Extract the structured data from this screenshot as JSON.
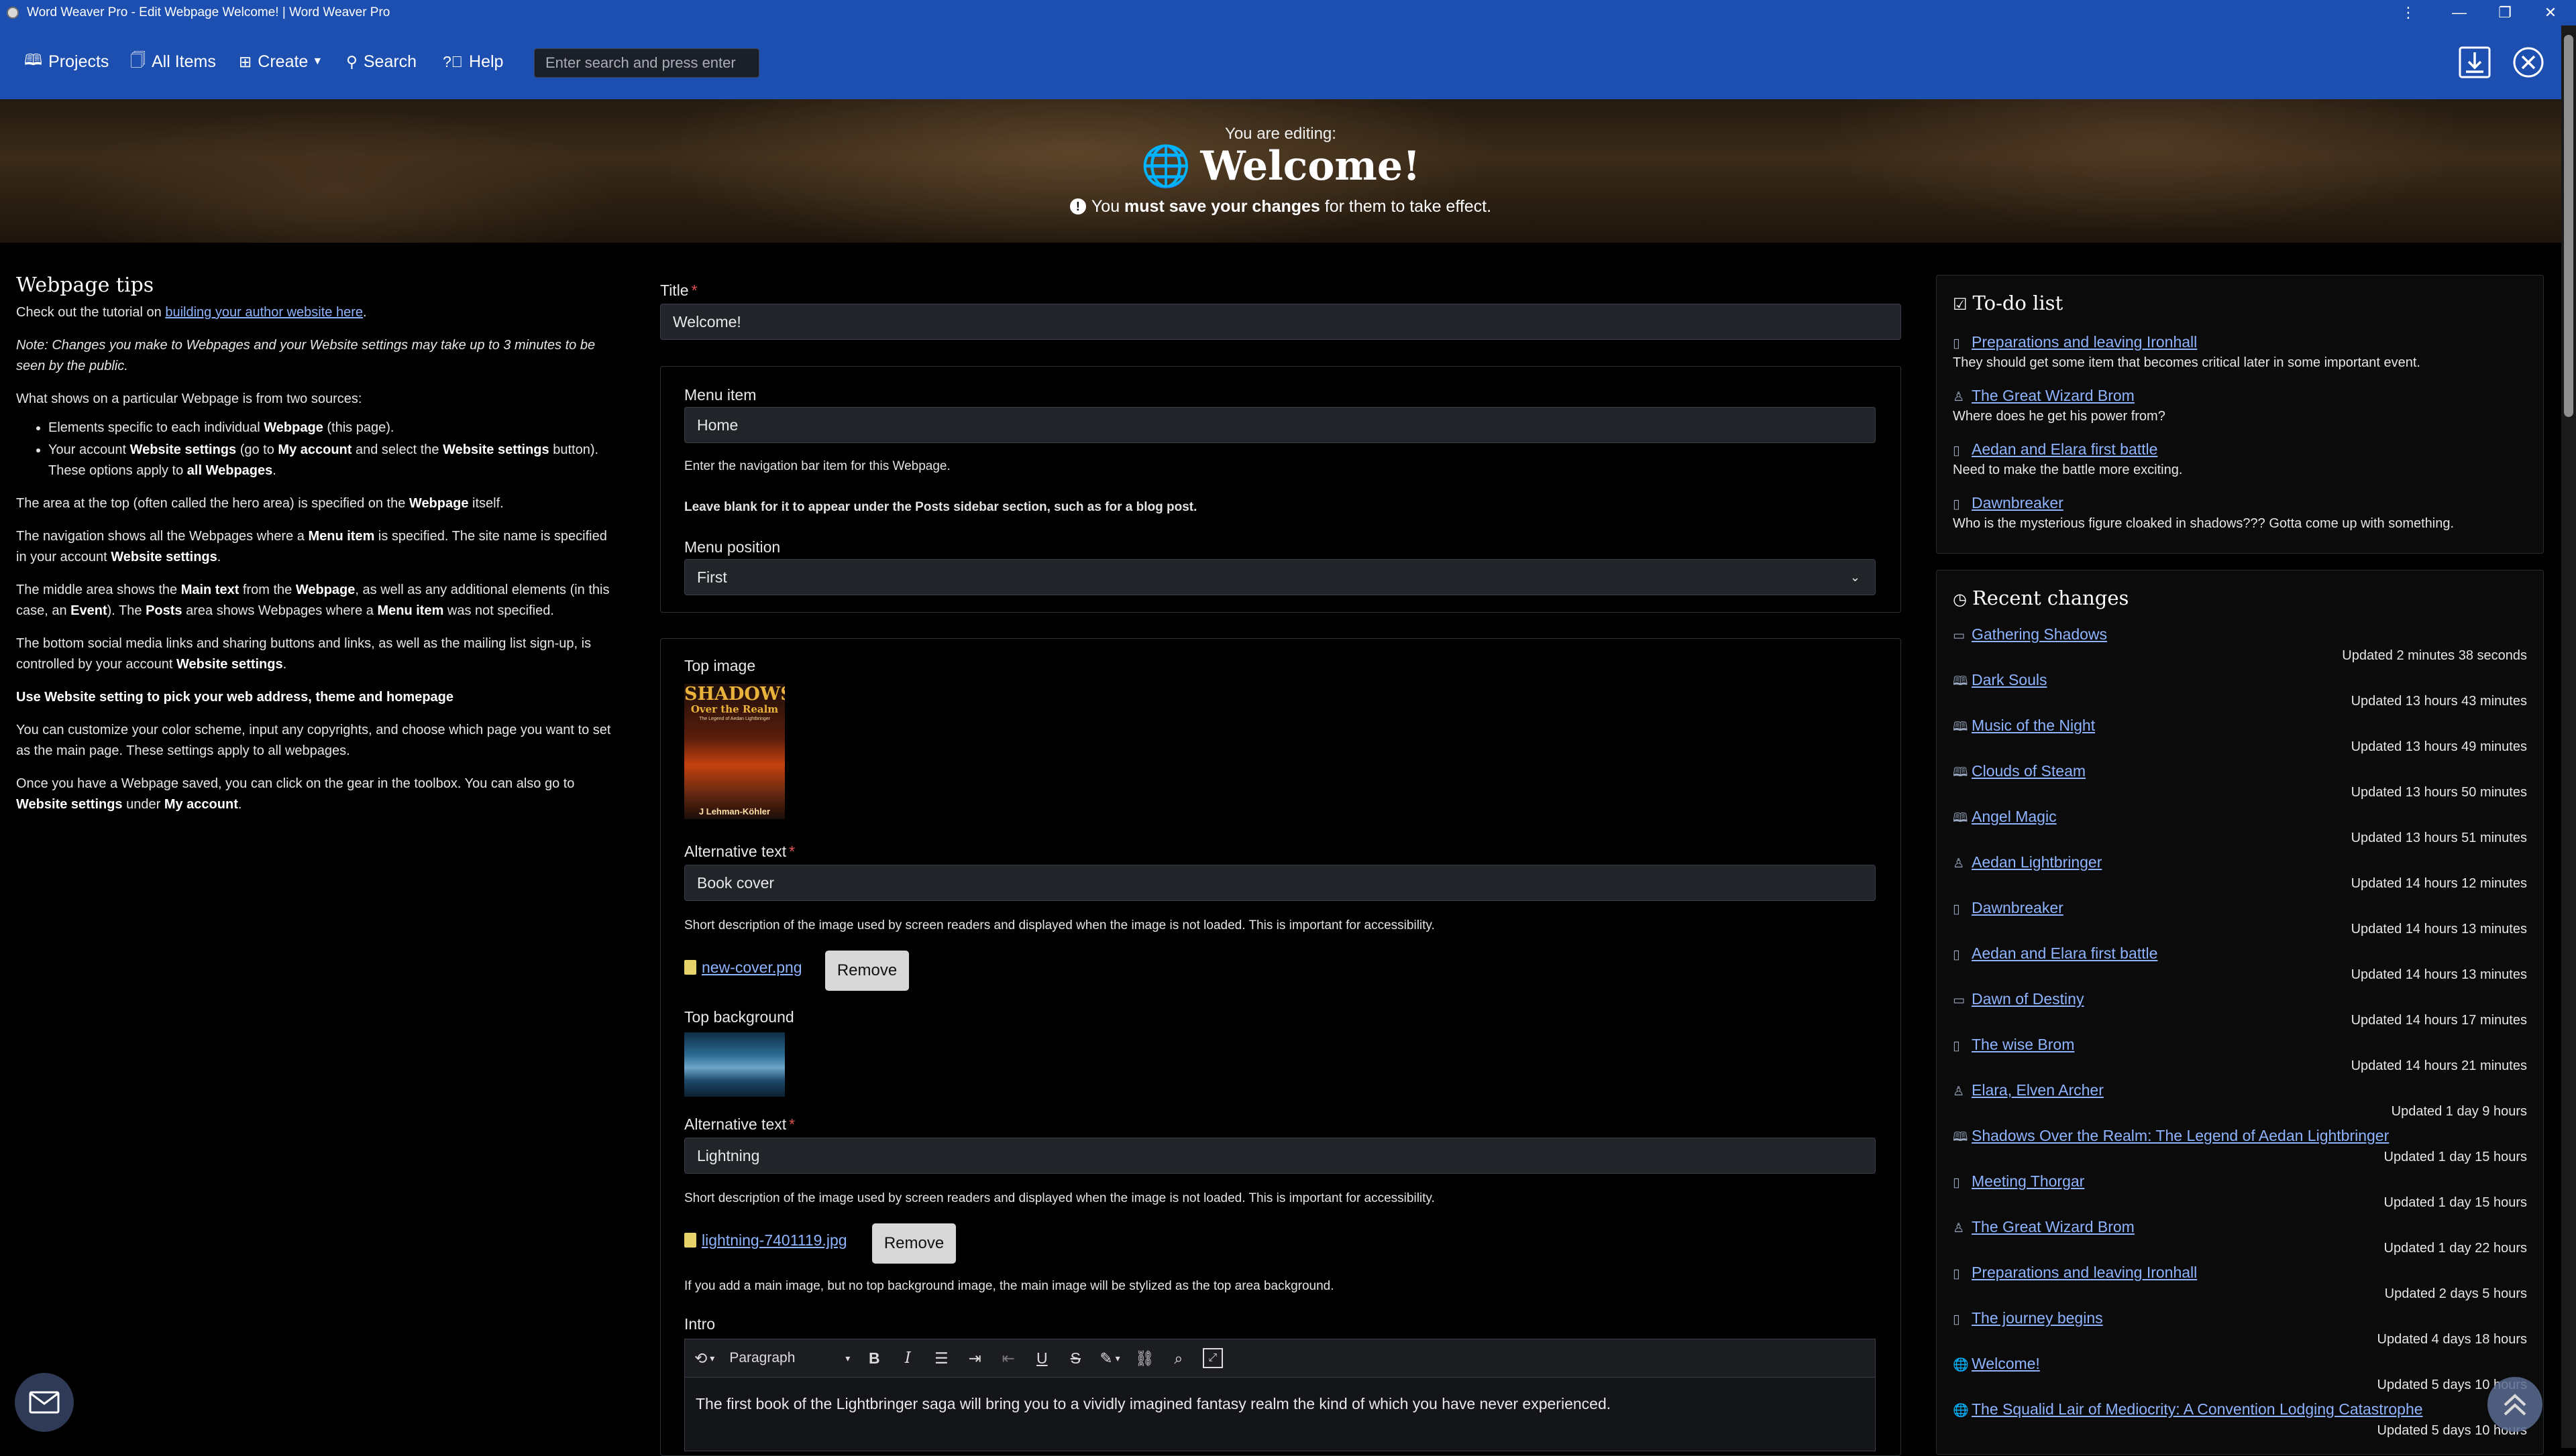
{
  "window": {
    "title": "Word Weaver Pro - Edit Webpage Welcome! | Word Weaver Pro",
    "controls": [
      "more",
      "minimize",
      "restore",
      "close"
    ]
  },
  "nav": {
    "projects": "Projects",
    "all_items": "All Items",
    "create": "Create",
    "search": "Search",
    "help": "Help",
    "search_placeholder": "Enter search and press enter"
  },
  "hero": {
    "editing_label": "You are editing:",
    "title": "Welcome!",
    "notice_pre": "You ",
    "notice_bold": "must save your changes",
    "notice_post": " for them to take effect."
  },
  "tips": {
    "heading": "Webpage tips",
    "p1_pre": "Check out the tutorial on ",
    "p1_link": "building your author website here",
    "p1_post": ".",
    "note": "Note: Changes you make to Webpages and your Website settings may take up to 3 minutes to be seen by the public.",
    "sources_intro_pre": "What shows on a particular Webpage is from two sources:",
    "li1_pre": "Elements specific to each individual ",
    "li1_bold": "Webpage",
    "li1_post": " (this page).",
    "li2_a": "Your account ",
    "li2_b": "Website settings",
    "li2_c": " (go to ",
    "li2_d": "My account",
    "li2_e": " and select the ",
    "li2_f": "Website settings",
    "li2_g": " button). These options apply to ",
    "li2_h": "all Webpages",
    "li2_i": ".",
    "hero_pre": "The area at the top (often called the hero area) is specified on the ",
    "hero_bold": "Webpage",
    "hero_post": " itself.",
    "nav_a": "The navigation shows all the Webpages where a ",
    "nav_b": "Menu item",
    "nav_c": " is specified. The site name is specified in your account ",
    "nav_d": "Website settings",
    "nav_e": ".",
    "mid_a": "The middle area shows the ",
    "mid_b": "Main text",
    "mid_c": " from the ",
    "mid_d": "Webpage",
    "mid_e": ", as well as any additional elements (in this case, an ",
    "mid_f": "Event",
    "mid_g": "). The ",
    "mid_h": "Posts",
    "mid_i": " area shows Webpages where a ",
    "mid_j": "Menu item",
    "mid_k": " was not specified.",
    "bottom_a": "The bottom social media links and sharing buttons and links, as well as the mailing list sign-up, is controlled by your account ",
    "bottom_b": "Website settings",
    "bottom_c": ".",
    "bold_line": "Use Website setting to pick your web address, theme and homepage",
    "custom": "You can customize your color scheme, input any copyrights, and choose which page you want to set as the main page. These settings apply to all webpages.",
    "once_a": "Once you have a Webpage saved, you can click on the gear in the toolbox. You can also go to ",
    "once_b": "Website settings",
    "once_c": " under ",
    "once_d": "My account",
    "once_e": "."
  },
  "form": {
    "title_label": "Title",
    "title_value": "Welcome!",
    "menu_item_label": "Menu item",
    "menu_item_value": "Home",
    "menu_hint": "Enter the navigation bar item for this Webpage.",
    "menu_hint_bold": "Leave blank for it to appear under the Posts sidebar section, such as for a blog post.",
    "menu_position_label": "Menu position",
    "menu_position_value": "First",
    "top_image_label": "Top image",
    "cover": {
      "title_line1": "SHADOWS",
      "title_line2": "Over the Realm",
      "subtitle": "The Legend of Aedan Lightbringer",
      "author": "J Lehman-Köhler"
    },
    "alt1_label": "Alternative text",
    "alt1_value": "Book cover",
    "alt_hint": "Short description of the image used by screen readers and displayed when the image is not loaded. This is important for accessibility.",
    "file1": "new-cover.png",
    "remove_label": "Remove",
    "top_bg_label": "Top background",
    "alt2_label": "Alternative text",
    "alt2_value": "Lightning",
    "alt_hint2": "Short description of the image used by screen readers and displayed when the image is not loaded. This is important for accessibility.",
    "file2": "lightning-7401119.jpg",
    "remove_label2": "Remove",
    "main_image_hint": "If you add a main image, but no top background image, the main image will be stylized as the top area background.",
    "intro_label": "Intro",
    "paragraph_select": "Paragraph",
    "intro_text": "The first book of the Lightbringer saga will bring you to a vividly imagined fantasy realm the kind of which you have never experienced."
  },
  "todo": {
    "heading": "To-do list",
    "items": [
      {
        "icon": "book-icon",
        "link": "Preparations and leaving Ironhall",
        "desc": "They should get some item that becomes critical later in some important event."
      },
      {
        "icon": "person-icon",
        "link": "The Great Wizard Brom",
        "desc": "Where does he get his power from?"
      },
      {
        "icon": "book-icon",
        "link": "Aedan and Elara first battle",
        "desc": "Need to make the battle more exciting."
      },
      {
        "icon": "book-icon",
        "link": "Dawnbreaker",
        "desc": "Who is the mysterious figure cloaked in shadows??? Gotta come up with something."
      }
    ]
  },
  "recent": {
    "heading": "Recent changes",
    "items": [
      {
        "icon": "chapter-icon",
        "link": "Gathering Shadows",
        "time": "Updated 2 minutes 38 seconds"
      },
      {
        "icon": "open-book-icon",
        "link": "Dark Souls",
        "time": "Updated 13 hours 43 minutes"
      },
      {
        "icon": "open-book-icon",
        "link": "Music of the Night",
        "time": "Updated 13 hours 49 minutes"
      },
      {
        "icon": "open-book-icon",
        "link": "Clouds of Steam",
        "time": "Updated 13 hours 50 minutes"
      },
      {
        "icon": "open-book-icon",
        "link": "Angel Magic",
        "time": "Updated 13 hours 51 minutes"
      },
      {
        "icon": "person-icon",
        "link": "Aedan Lightbringer",
        "time": "Updated 14 hours 12 minutes"
      },
      {
        "icon": "book-icon",
        "link": "Dawnbreaker",
        "time": "Updated 14 hours 13 minutes"
      },
      {
        "icon": "book-icon",
        "link": "Aedan and Elara first battle",
        "time": "Updated 14 hours 13 minutes"
      },
      {
        "icon": "chapter-icon",
        "link": "Dawn of Destiny",
        "time": "Updated 14 hours 17 minutes"
      },
      {
        "icon": "book-icon",
        "link": "The wise Brom",
        "time": "Updated 14 hours 21 minutes"
      },
      {
        "icon": "person-icon",
        "link": "Elara, Elven Archer",
        "time": "Updated 1 day 9 hours"
      },
      {
        "icon": "open-book-icon",
        "link": "Shadows Over the Realm: The Legend of Aedan Lightbringer",
        "time": "Updated 1 day 15 hours"
      },
      {
        "icon": "book-icon",
        "link": "Meeting Thorgar",
        "time": "Updated 1 day 15 hours"
      },
      {
        "icon": "person-icon",
        "link": "The Great Wizard Brom",
        "time": "Updated 1 day 22 hours"
      },
      {
        "icon": "book-icon",
        "link": "Preparations and leaving Ironhall",
        "time": "Updated 2 days 5 hours"
      },
      {
        "icon": "book-icon",
        "link": "The journey begins",
        "time": "Updated 4 days 18 hours"
      },
      {
        "icon": "globe-icon",
        "link": "Welcome!",
        "time": "Updated 5 days 10 hours"
      },
      {
        "icon": "globe-icon",
        "link": "The Squalid Lair of Mediocrity: A Convention Lodging Catastrophe",
        "time": "Updated 5 days 10 hours"
      }
    ]
  },
  "colors": {
    "nav_blue": "#1c4fb0",
    "link": "#8fb4ff",
    "required": "#e05252"
  }
}
